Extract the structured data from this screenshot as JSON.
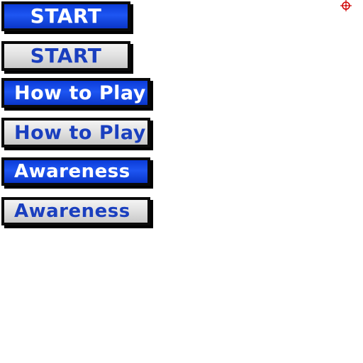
{
  "buttons": {
    "start_label": "START",
    "start_pressed_label": "START",
    "how_to_play_label": "How to Play",
    "how_to_play_pressed_label": "How to Play",
    "awareness_label": "Awareness",
    "awareness_pressed_label": "Awareness"
  },
  "icons": {
    "crosshair": "crosshair-icon"
  },
  "colors": {
    "button_blue": "#1e56f2",
    "button_grey": "#e0e0e0",
    "text_blue": "#1a3fbf",
    "border": "#000000",
    "crosshair_red": "#d00000"
  }
}
